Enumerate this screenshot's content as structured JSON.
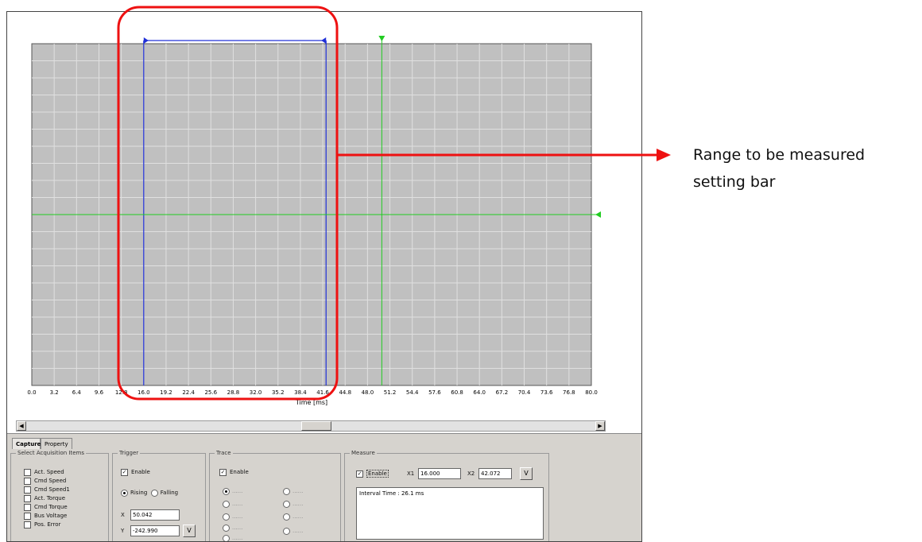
{
  "chart_data": {
    "type": "line",
    "xlabel": "Time [ms]",
    "xlim": [
      0,
      80
    ],
    "x_ticks": [
      "0.0",
      "3.2",
      "6.4",
      "9.6",
      "12.8",
      "16.0",
      "19.2",
      "22.4",
      "25.6",
      "28.8",
      "32.0",
      "35.2",
      "38.4",
      "41.6",
      "44.8",
      "48.0",
      "51.2",
      "54.4",
      "57.6",
      "60.8",
      "64.0",
      "67.2",
      "70.4",
      "73.6",
      "76.8",
      "80.0"
    ],
    "grid": true,
    "series": [],
    "cursors": {
      "x1": 16.0,
      "x2": 42.072,
      "trigger_x": 50.042
    }
  },
  "colors": {
    "plot_bg": "#c0c0c0",
    "grid": "#e0e0e0",
    "cursor": "#2030d8",
    "trigger": "#22cc22",
    "highlight": "#ee1111"
  },
  "tabs": [
    "Capture",
    "Property"
  ],
  "acquisition": {
    "title": "Select Acquisition Items",
    "items": [
      "Act. Speed",
      "Cmd Speed",
      "Cmd Speed1",
      "Act. Torque",
      "Cmd Torque",
      "Bus Voltage",
      "Pos. Error"
    ]
  },
  "trigger": {
    "title": "Trigger",
    "enable_label": "Enable",
    "enabled": true,
    "rising_label": "Rising",
    "falling_label": "Falling",
    "edge": "rising",
    "x_label": "X",
    "x_value": "50.042",
    "y_label": "Y",
    "y_value": "-242.990",
    "v_button": "V"
  },
  "trace": {
    "title": "Trace",
    "enable_label": "Enable",
    "enabled": true,
    "options": [
      "......",
      "......",
      "......",
      "......",
      "......",
      "......",
      "......",
      "......",
      "......"
    ]
  },
  "measure": {
    "title": "Measure",
    "enable_label": "Enable",
    "enabled": true,
    "x1_label": "X1",
    "x1_value": "16.000",
    "x2_label": "X2",
    "x2_value": "42.072",
    "v_button": "V",
    "result": "Interval Time : 26.1 ms"
  },
  "scrollbar": {
    "left_icon": "arrow-left-icon",
    "right_icon": "arrow-right-icon"
  },
  "annotation": {
    "line1": "Range to be measured",
    "line2": "setting bar"
  }
}
